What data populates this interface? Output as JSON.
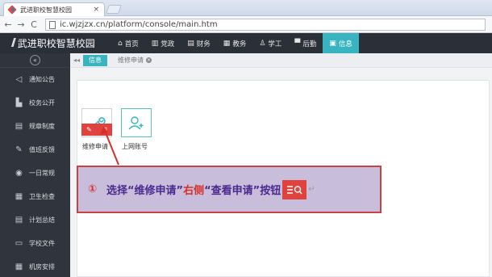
{
  "browser": {
    "tab_title": "武进职校智慧校园",
    "tab_close": "×",
    "url": "ic.wjzjzx.cn/platform/console/main.htm",
    "back": "←",
    "forward": "→",
    "reload": "C"
  },
  "header": {
    "brand": "武进职校智慧校园",
    "nav": [
      {
        "label": "首页",
        "icon": "home-icon",
        "glyph": "⌂"
      },
      {
        "label": "党政",
        "icon": "building-icon",
        "glyph": "▥"
      },
      {
        "label": "财务",
        "icon": "wallet-icon",
        "glyph": "▤"
      },
      {
        "label": "教务",
        "icon": "book-icon",
        "glyph": "▦"
      },
      {
        "label": "学工",
        "icon": "user-icon",
        "glyph": "♙"
      },
      {
        "label": "后勤",
        "icon": "flag-icon",
        "glyph": "▀"
      },
      {
        "label": "信息",
        "icon": "info-icon",
        "glyph": "▣"
      }
    ]
  },
  "sidebar": {
    "collapse": "«",
    "items": [
      {
        "label": "通知公告",
        "icon": "megaphone-icon",
        "glyph": "◁"
      },
      {
        "label": "校务公开",
        "icon": "document-icon",
        "glyph": "▙"
      },
      {
        "label": "规章制度",
        "icon": "list-icon",
        "glyph": "▤"
      },
      {
        "label": "值班反馈",
        "icon": "edit-icon",
        "glyph": "✎"
      },
      {
        "label": "一日常规",
        "icon": "circle-icon",
        "glyph": "◉"
      },
      {
        "label": "卫生检查",
        "icon": "checklist-icon",
        "glyph": "▦"
      },
      {
        "label": "计划总结",
        "icon": "list-icon",
        "glyph": "▤"
      },
      {
        "label": "学校文件",
        "icon": "folder-icon",
        "glyph": "▭"
      },
      {
        "label": "机房安排",
        "icon": "grid-icon",
        "glyph": "▦"
      }
    ]
  },
  "content": {
    "back": "◂◂",
    "tabs": [
      {
        "label": "信息",
        "active": true
      },
      {
        "label": "维修申请",
        "active": false
      }
    ],
    "tiles": [
      {
        "label": "维修申请",
        "icon": "wrench-icon"
      },
      {
        "label": "上网账号",
        "icon": "user-add-icon"
      }
    ]
  },
  "callout": {
    "number": "①",
    "part1": "选择“维修申请”",
    "part2": "右侧",
    "part3": "“查看申请”按钮",
    "return": "↵"
  },
  "colors": {
    "accent": "#37b4bf",
    "header_bg": "#2b2f38",
    "sidebar_bg": "#2f343d",
    "action_red": "#e0433e",
    "callout_bg": "#c8bedb"
  }
}
